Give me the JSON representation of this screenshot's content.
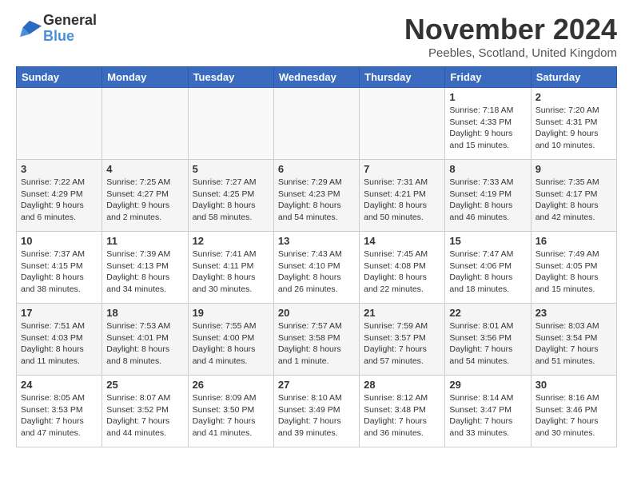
{
  "logo": {
    "line1": "General",
    "line2": "Blue"
  },
  "title": "November 2024",
  "subtitle": "Peebles, Scotland, United Kingdom",
  "weekdays": [
    "Sunday",
    "Monday",
    "Tuesday",
    "Wednesday",
    "Thursday",
    "Friday",
    "Saturday"
  ],
  "weeks": [
    [
      {
        "day": "",
        "info": ""
      },
      {
        "day": "",
        "info": ""
      },
      {
        "day": "",
        "info": ""
      },
      {
        "day": "",
        "info": ""
      },
      {
        "day": "",
        "info": ""
      },
      {
        "day": "1",
        "info": "Sunrise: 7:18 AM\nSunset: 4:33 PM\nDaylight: 9 hours and 15 minutes."
      },
      {
        "day": "2",
        "info": "Sunrise: 7:20 AM\nSunset: 4:31 PM\nDaylight: 9 hours and 10 minutes."
      }
    ],
    [
      {
        "day": "3",
        "info": "Sunrise: 7:22 AM\nSunset: 4:29 PM\nDaylight: 9 hours and 6 minutes."
      },
      {
        "day": "4",
        "info": "Sunrise: 7:25 AM\nSunset: 4:27 PM\nDaylight: 9 hours and 2 minutes."
      },
      {
        "day": "5",
        "info": "Sunrise: 7:27 AM\nSunset: 4:25 PM\nDaylight: 8 hours and 58 minutes."
      },
      {
        "day": "6",
        "info": "Sunrise: 7:29 AM\nSunset: 4:23 PM\nDaylight: 8 hours and 54 minutes."
      },
      {
        "day": "7",
        "info": "Sunrise: 7:31 AM\nSunset: 4:21 PM\nDaylight: 8 hours and 50 minutes."
      },
      {
        "day": "8",
        "info": "Sunrise: 7:33 AM\nSunset: 4:19 PM\nDaylight: 8 hours and 46 minutes."
      },
      {
        "day": "9",
        "info": "Sunrise: 7:35 AM\nSunset: 4:17 PM\nDaylight: 8 hours and 42 minutes."
      }
    ],
    [
      {
        "day": "10",
        "info": "Sunrise: 7:37 AM\nSunset: 4:15 PM\nDaylight: 8 hours and 38 minutes."
      },
      {
        "day": "11",
        "info": "Sunrise: 7:39 AM\nSunset: 4:13 PM\nDaylight: 8 hours and 34 minutes."
      },
      {
        "day": "12",
        "info": "Sunrise: 7:41 AM\nSunset: 4:11 PM\nDaylight: 8 hours and 30 minutes."
      },
      {
        "day": "13",
        "info": "Sunrise: 7:43 AM\nSunset: 4:10 PM\nDaylight: 8 hours and 26 minutes."
      },
      {
        "day": "14",
        "info": "Sunrise: 7:45 AM\nSunset: 4:08 PM\nDaylight: 8 hours and 22 minutes."
      },
      {
        "day": "15",
        "info": "Sunrise: 7:47 AM\nSunset: 4:06 PM\nDaylight: 8 hours and 18 minutes."
      },
      {
        "day": "16",
        "info": "Sunrise: 7:49 AM\nSunset: 4:05 PM\nDaylight: 8 hours and 15 minutes."
      }
    ],
    [
      {
        "day": "17",
        "info": "Sunrise: 7:51 AM\nSunset: 4:03 PM\nDaylight: 8 hours and 11 minutes."
      },
      {
        "day": "18",
        "info": "Sunrise: 7:53 AM\nSunset: 4:01 PM\nDaylight: 8 hours and 8 minutes."
      },
      {
        "day": "19",
        "info": "Sunrise: 7:55 AM\nSunset: 4:00 PM\nDaylight: 8 hours and 4 minutes."
      },
      {
        "day": "20",
        "info": "Sunrise: 7:57 AM\nSunset: 3:58 PM\nDaylight: 8 hours and 1 minute."
      },
      {
        "day": "21",
        "info": "Sunrise: 7:59 AM\nSunset: 3:57 PM\nDaylight: 7 hours and 57 minutes."
      },
      {
        "day": "22",
        "info": "Sunrise: 8:01 AM\nSunset: 3:56 PM\nDaylight: 7 hours and 54 minutes."
      },
      {
        "day": "23",
        "info": "Sunrise: 8:03 AM\nSunset: 3:54 PM\nDaylight: 7 hours and 51 minutes."
      }
    ],
    [
      {
        "day": "24",
        "info": "Sunrise: 8:05 AM\nSunset: 3:53 PM\nDaylight: 7 hours and 47 minutes."
      },
      {
        "day": "25",
        "info": "Sunrise: 8:07 AM\nSunset: 3:52 PM\nDaylight: 7 hours and 44 minutes."
      },
      {
        "day": "26",
        "info": "Sunrise: 8:09 AM\nSunset: 3:50 PM\nDaylight: 7 hours and 41 minutes."
      },
      {
        "day": "27",
        "info": "Sunrise: 8:10 AM\nSunset: 3:49 PM\nDaylight: 7 hours and 39 minutes."
      },
      {
        "day": "28",
        "info": "Sunrise: 8:12 AM\nSunset: 3:48 PM\nDaylight: 7 hours and 36 minutes."
      },
      {
        "day": "29",
        "info": "Sunrise: 8:14 AM\nSunset: 3:47 PM\nDaylight: 7 hours and 33 minutes."
      },
      {
        "day": "30",
        "info": "Sunrise: 8:16 AM\nSunset: 3:46 PM\nDaylight: 7 hours and 30 minutes."
      }
    ]
  ]
}
